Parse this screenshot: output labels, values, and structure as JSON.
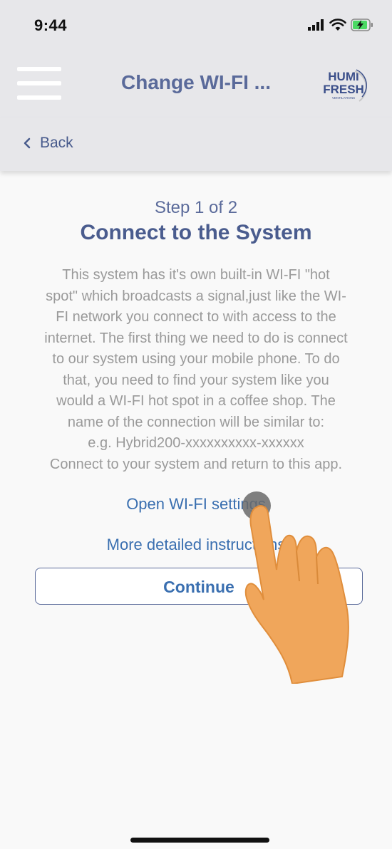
{
  "status_bar": {
    "time": "9:44",
    "icons": [
      "signal-icon",
      "wifi-icon",
      "battery-charging-icon"
    ]
  },
  "nav": {
    "title": "Change WI-FI ...",
    "logo_line1": "HUMI",
    "logo_line2": "FRESH",
    "logo_tagline": "VENTILATIONS"
  },
  "back": {
    "label": "Back"
  },
  "content": {
    "step_label": "Step 1 of 2",
    "title": "Connect to the System",
    "instruction_lines": [
      "This system has it's own built-in WI-FI \"hot",
      "spot\" which broadcasts a signal,just like the WI-",
      "FI network you connect to with access to the",
      "internet. The first thing we need to do is connect",
      "to our system using your mobile phone. To do",
      "that, you need to find your system like you",
      "would a WI-FI hot spot in a coffee shop. The",
      "name of the connection will be similar to:",
      "e.g. Hybrid200-xxxxxxxxxx-xxxxxx",
      "Connect to your system and return to this app."
    ],
    "open_wifi_link": "Open WI-FI settings",
    "more_instructions_link": "More detailed instructions",
    "continue_button": "Continue"
  },
  "colors": {
    "header_bg": "#e7e7ea",
    "title_blue": "#4a5c8e",
    "link_blue": "#3a6fb0",
    "body_gray": "#9a9a9a",
    "hand_orange": "#f0a65b"
  }
}
